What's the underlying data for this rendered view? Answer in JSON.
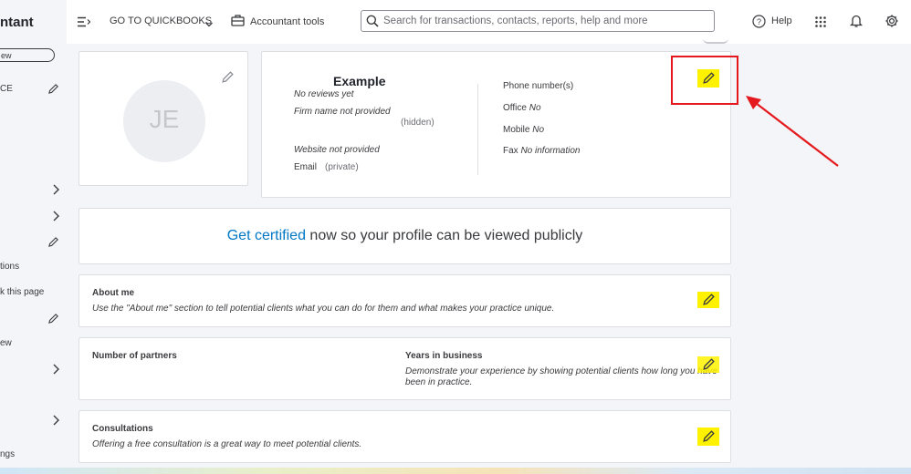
{
  "sidebar": {
    "brand": "ntant",
    "view_label": "ew",
    "items": [
      {
        "label": "CE"
      },
      {
        "label": "tions"
      },
      {
        "label": "k this page"
      },
      {
        "label": "ew"
      },
      {
        "label": "ngs"
      }
    ]
  },
  "topbar": {
    "goto_label": "GO TO QUICKBOOKS",
    "accountant_tools_label": "Accountant tools",
    "search_placeholder": "Search for transactions, contacts, reports, help and more",
    "help_label": "Help"
  },
  "profile": {
    "initials": "JE",
    "name": "Example",
    "reviews": "No reviews yet",
    "firm_name": "Firm name not provided",
    "hidden_note": "(hidden)",
    "website": "Website not provided",
    "email_label": "Email",
    "email_note": "(private)",
    "phone_header": "Phone number(s)",
    "office_label": "Office",
    "office_value": "No",
    "mobile_label": "Mobile",
    "mobile_value": "No",
    "fax_label": "Fax",
    "fax_value": "No information"
  },
  "certified": {
    "link": "Get certified",
    "rest": " now so your profile can be viewed publicly"
  },
  "about": {
    "title": "About me",
    "desc": "Use the \"About me\" section to tell potential clients what you can do for them and what makes your practice unique."
  },
  "partners": {
    "title": "Number of partners",
    "years_title": "Years in business",
    "years_desc_line1": "Demonstrate your experience by showing potential clients how long you have",
    "years_desc_line2": "been in practice."
  },
  "consultations": {
    "title": "Consultations",
    "desc": "Offering a free consultation is a great way to meet potential clients."
  },
  "colors": {
    "accent_link": "#0077c5",
    "annotation_red": "#e5191d",
    "highlight_yellow": "#fff200"
  },
  "icons": [
    "menu-icon",
    "chevron-down-icon",
    "briefcase-icon",
    "search-icon",
    "help-icon",
    "apps-grid-icon",
    "bell-icon",
    "gear-icon",
    "pencil-icon",
    "chevron-right-icon",
    "arrow-annotation"
  ]
}
